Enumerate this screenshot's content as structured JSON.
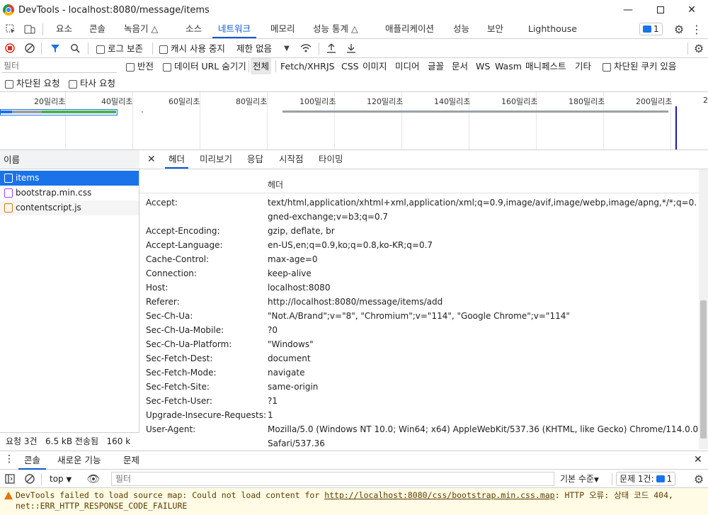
{
  "window": {
    "title": "DevTools - localhost:8080/message/items"
  },
  "panel_tabs": [
    {
      "label": "요소"
    },
    {
      "label": "콘솔"
    },
    {
      "label": "녹음기"
    },
    {
      "label": "소스"
    },
    {
      "label": "네트워크"
    },
    {
      "label": "메모리"
    },
    {
      "label": "성능 통계"
    },
    {
      "label": "애플리케이션"
    },
    {
      "label": "성능"
    },
    {
      "label": "보안"
    },
    {
      "label": "Lighthouse"
    }
  ],
  "issues_badge": "1",
  "toolbar": {
    "preserve_log": "로그 보존",
    "disable_cache": "캐시 사용 중지",
    "throttling": "제한 없음"
  },
  "filter": {
    "placeholder": "필터",
    "invert": "반전",
    "hide_data_urls": "데이터 URL 숨기기",
    "types": [
      "전체",
      "Fetch/XHR",
      "JS",
      "CSS",
      "이미지",
      "미디어",
      "글꼴",
      "문서",
      "WS",
      "Wasm",
      "매니페스트",
      "기타"
    ],
    "blocked_cookies": "차단된 쿠키 있음",
    "blocked_requests": "차단된 요청",
    "third_party": "타사 요청"
  },
  "timeline": {
    "ticks": [
      "20밀리초",
      "40밀리초",
      "60밀리초",
      "80밀리초",
      "100밀리초",
      "120밀리초",
      "140밀리초",
      "160밀리초",
      "180밀리초",
      "200밀리초",
      "2"
    ]
  },
  "requests": {
    "column_name": "이름",
    "items": [
      {
        "name": "items"
      },
      {
        "name": "bootstrap.min.css"
      },
      {
        "name": "contentscript.js"
      }
    ],
    "summary": "요청 3건   6.5 kB 전송됨   160 k"
  },
  "detail": {
    "tabs": [
      "헤더",
      "미리보기",
      "응답",
      "시작점",
      "타이밍"
    ],
    "section_label": "헤더",
    "headers": [
      {
        "name": "Accept:",
        "value": "text/html,application/xhtml+xml,application/xml;q=0.9,image/avif,image/webp,image/apng,*/*;q=0.8,application/si",
        "value2": "gned-exchange;v=b3;q=0.7"
      },
      {
        "name": "Accept-Encoding:",
        "value": "gzip, deflate, br"
      },
      {
        "name": "Accept-Language:",
        "value": "en-US,en;q=0.9,ko;q=0.8,ko-KR;q=0.7"
      },
      {
        "name": "Cache-Control:",
        "value": "max-age=0"
      },
      {
        "name": "Connection:",
        "value": "keep-alive"
      },
      {
        "name": "Host:",
        "value": "localhost:8080"
      },
      {
        "name": "Referer:",
        "value": "http://localhost:8080/message/items/add"
      },
      {
        "name": "Sec-Ch-Ua:",
        "value": "\"Not.A/Brand\";v=\"8\", \"Chromium\";v=\"114\", \"Google Chrome\";v=\"114\""
      },
      {
        "name": "Sec-Ch-Ua-Mobile:",
        "value": "?0"
      },
      {
        "name": "Sec-Ch-Ua-Platform:",
        "value": "\"Windows\""
      },
      {
        "name": "Sec-Fetch-Dest:",
        "value": "document"
      },
      {
        "name": "Sec-Fetch-Mode:",
        "value": "navigate"
      },
      {
        "name": "Sec-Fetch-Site:",
        "value": "same-origin"
      },
      {
        "name": "Sec-Fetch-User:",
        "value": "?1"
      },
      {
        "name": "Upgrade-Insecure-Requests:",
        "value": "1"
      },
      {
        "name": "User-Agent:",
        "value": "Mozilla/5.0 (Windows NT 10.0; Win64; x64) AppleWebKit/537.36 (KHTML, like Gecko) Chrome/114.0.0.0",
        "value2": "Safari/537.36"
      }
    ]
  },
  "drawer": {
    "tabs": [
      "콘솔",
      "새로운 기능",
      "문제"
    ],
    "context": "top",
    "filter_placeholder": "필터",
    "levels": "기본 수준",
    "issues": "문제 1건:",
    "issues_count": "1"
  },
  "warning": {
    "prefix": "DevTools failed to load source map: Could not load content for ",
    "url": "http://localhost:8080/css/bootstrap.min.css.map",
    "suffix": ": HTTP 오류: 상태 코드 404,",
    "line2": "net::ERR_HTTP_RESPONSE_CODE_FAILURE"
  },
  "colors": {
    "accent": "#1a73e8",
    "selected_tab": "#0b57d0",
    "warning_bg": "#fffbe5"
  }
}
